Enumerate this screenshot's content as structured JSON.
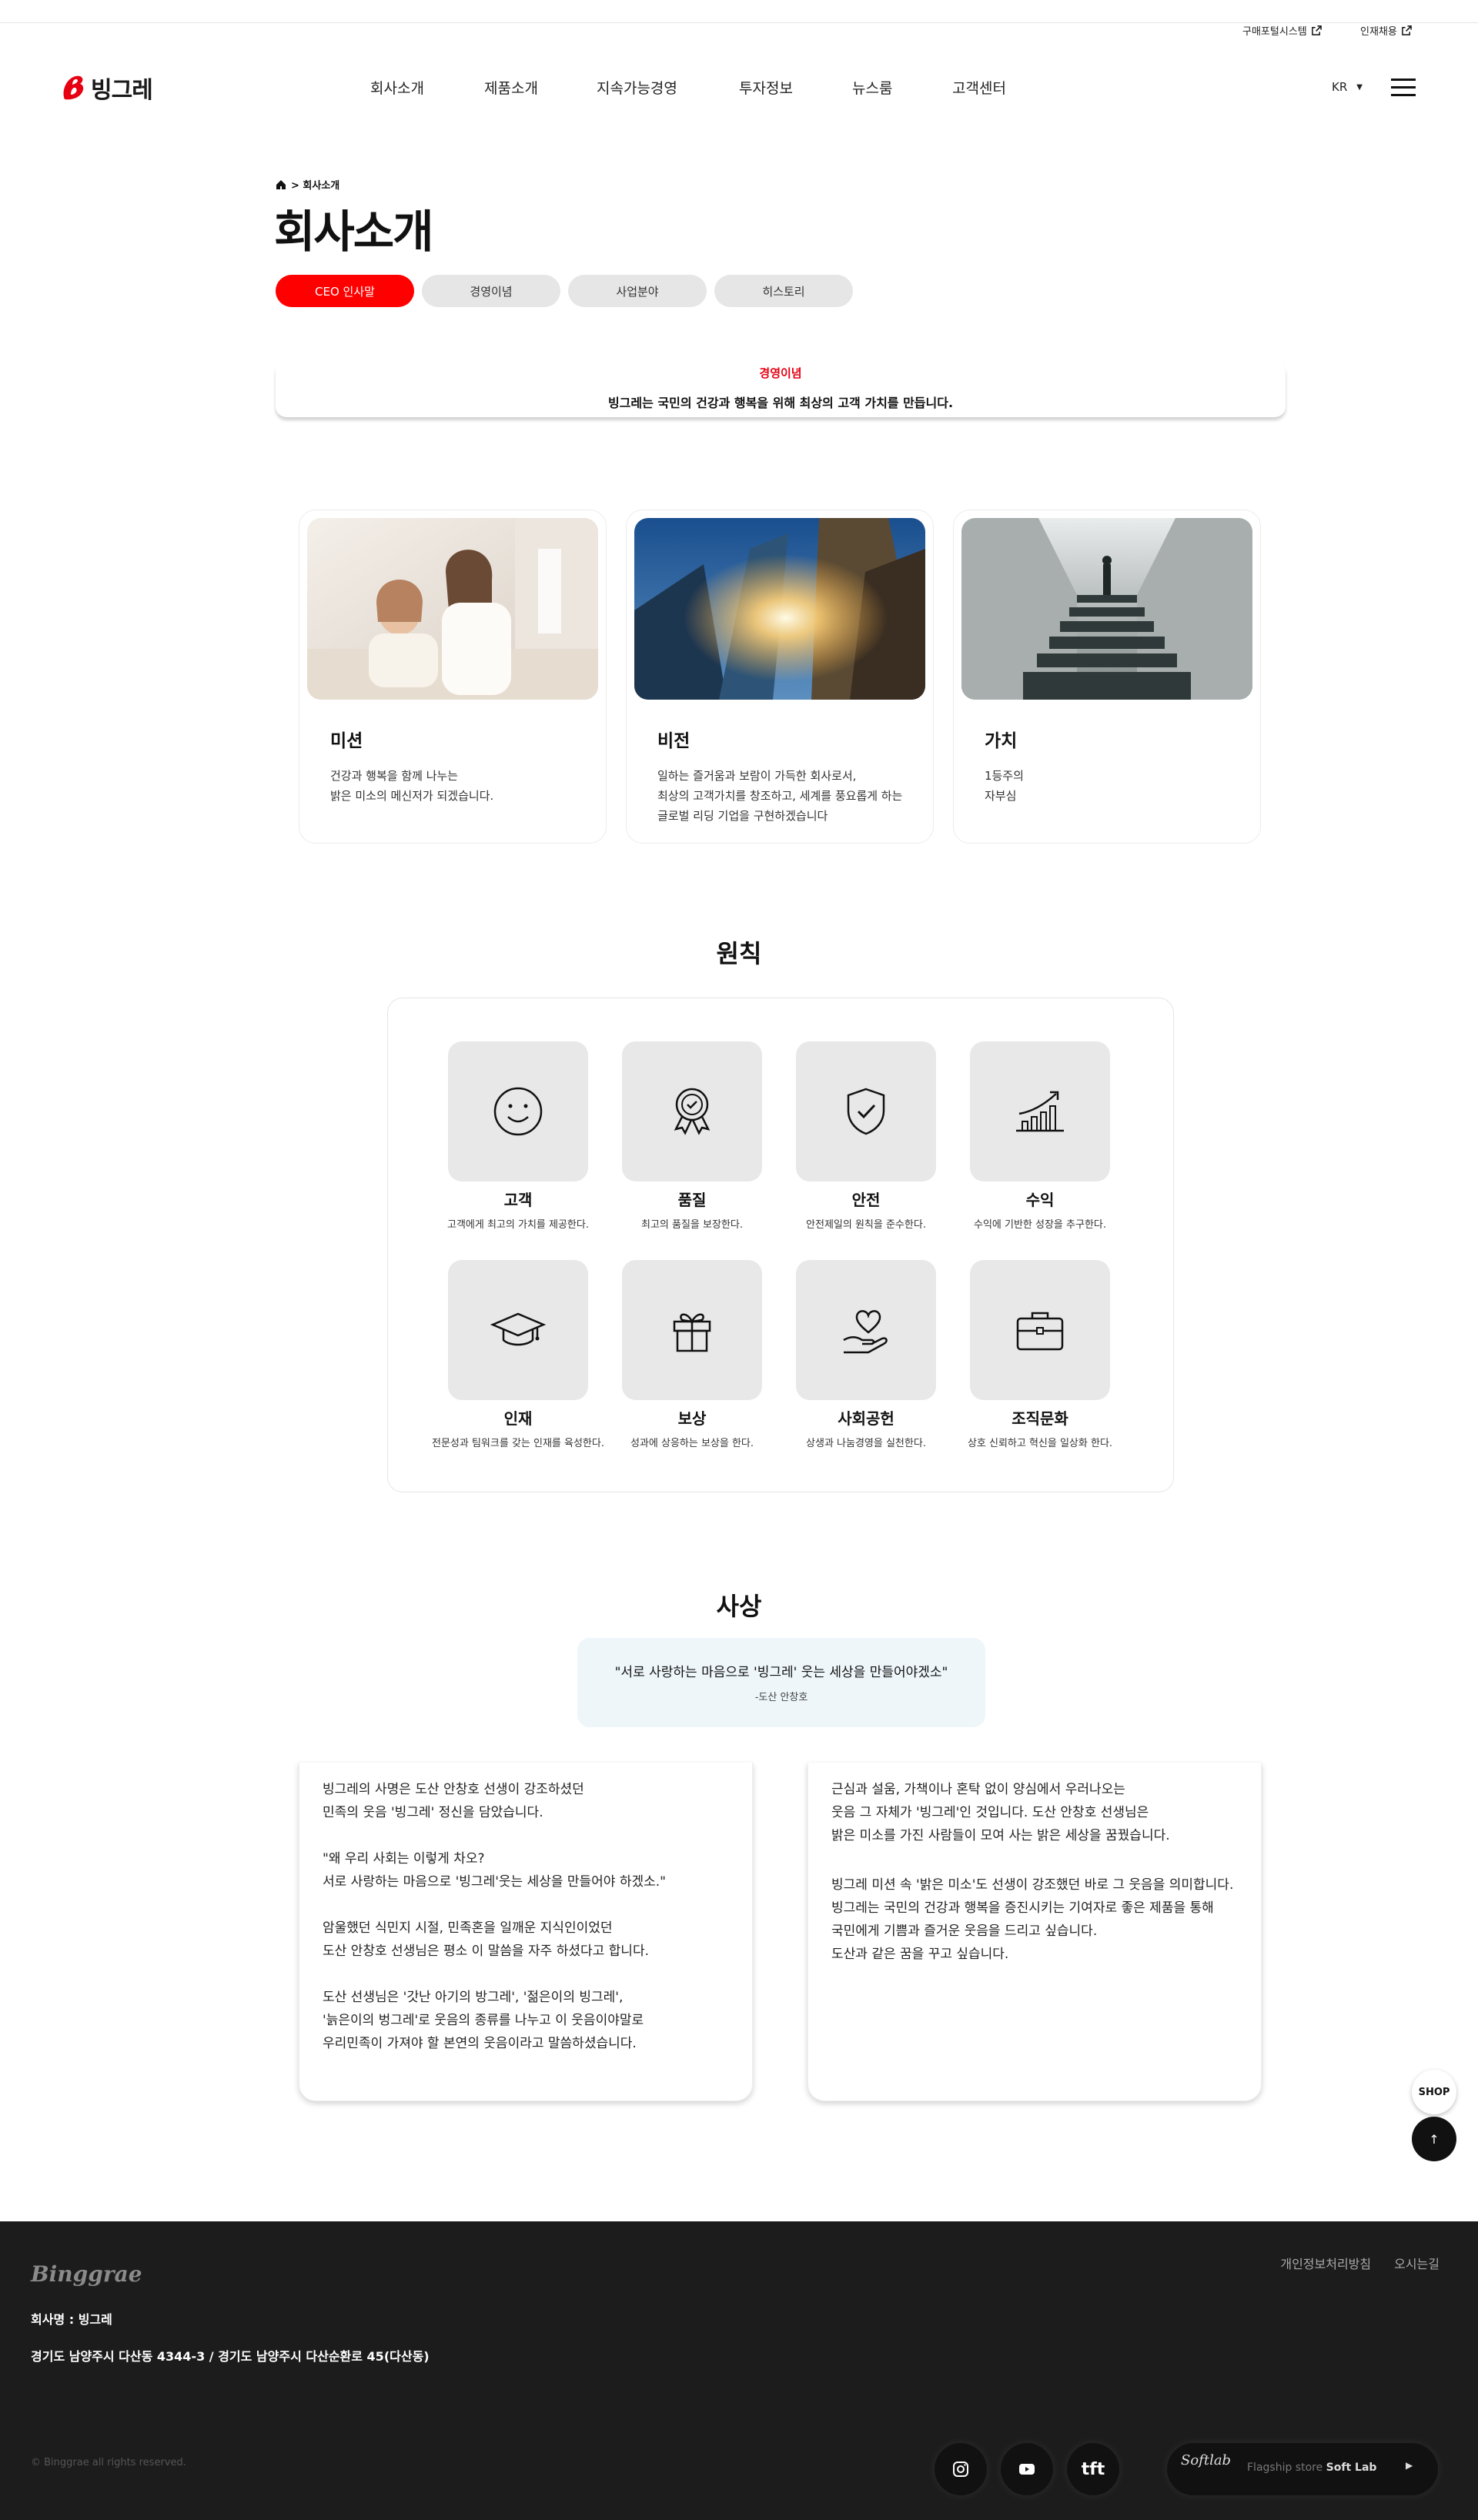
{
  "util": {
    "purchase_portal": "구매포털시스템",
    "recruit": "인재채용"
  },
  "header": {
    "logo_text": "빙그레",
    "nav": [
      "회사소개",
      "제품소개",
      "지속가능경영",
      "투자정보",
      "뉴스룸",
      "고객센터"
    ],
    "lang": "KR"
  },
  "page": {
    "breadcrumb": "> 회사소개",
    "title": "회사소개",
    "tabs": [
      "CEO 인사말",
      "경영이념",
      "사업분야",
      "히스토리"
    ]
  },
  "notice": {
    "label": "경영이념",
    "text": "빙그레는 국민의 건강과 행복을 위해 최상의 고객 가치를 만듭니다."
  },
  "cards": [
    {
      "title": "미션",
      "lines": [
        "건강과 행복을 함께 나누는",
        "밝은 미소의 메신저가 되겠습니다."
      ]
    },
    {
      "title": "비전",
      "lines": [
        "일하는 즐거움과 보람이 가득한 회사로서,",
        "최상의 고객가치를 창조하고, 세계를 풍요롭게 하는",
        "글로벌 리딩 기업을 구현하겠습니다"
      ]
    },
    {
      "title": "가치",
      "lines": [
        "1등주의",
        "자부심"
      ]
    }
  ],
  "principles": {
    "title": "원칙",
    "items": [
      {
        "title": "고객",
        "desc": "고객에게 최고의 가치를 제공한다.",
        "icon": "smile-icon"
      },
      {
        "title": "품질",
        "desc": "최고의 품질을 보장한다.",
        "icon": "medal-icon"
      },
      {
        "title": "안전",
        "desc": "안전제일의 원칙을 준수한다.",
        "icon": "shield-icon"
      },
      {
        "title": "수익",
        "desc": "수익에 기반한 성장을 추구한다.",
        "icon": "growth-chart-icon"
      },
      {
        "title": "인재",
        "desc": "전문성과 팀워크를 갖는 인재를 육성한다.",
        "icon": "graduation-cap-icon"
      },
      {
        "title": "보상",
        "desc": "성과에 상응하는 보상을 한다.",
        "icon": "gift-icon"
      },
      {
        "title": "사회공헌",
        "desc": "상생과 나눔경영을 실천한다.",
        "icon": "heart-hand-icon"
      },
      {
        "title": "조직문화",
        "desc": "상호 신뢰하고 혁신을 일상화 한다.",
        "icon": "briefcase-icon"
      }
    ]
  },
  "motto": {
    "title": "사상",
    "quote": "\"서로 사랑하는 마음으로 '빙그레' 웃는 세상을 만들어야겠소\"",
    "author": "-도산 안창호",
    "left_paragraphs": [
      [
        "빙그레의 사명은 도산 안창호 선생이 강조하셨던",
        "민족의 웃음 '빙그레' 정신을 담았습니다."
      ],
      [
        "\"왜 우리 사회는 이렇게 차오?",
        "서로 사랑하는 마음으로 '빙그레'웃는 세상을 만들어야 하겠소.\""
      ],
      [
        "암울했던 식민지 시절, 민족혼을 일깨운 지식인이었던",
        "도산 안창호 선생님은 평소 이 말씀을 자주 하셨다고 합니다."
      ],
      [
        "도산 선생님은 '갓난 아기의 방그레', '젊은이의 빙그레',",
        "'늙은이의 벙그레'로 웃음의 종류를 나누고 이 웃음이야말로",
        "우리민족이 가져야 할 본연의 웃음이라고 말씀하셨습니다."
      ]
    ],
    "right_paragraphs": [
      [
        "근심과 설움, 가책이나 혼탁 없이 양심에서 우러나오는",
        "웃음 그 자체가 '빙그레'인 것입니다. 도산 안창호 선생님은",
        "밝은 미소를 가진 사람들이 모여 사는 밝은 세상을 꿈꿨습니다."
      ],
      [
        "빙그레 미션 속 '밝은 미소'도 선생이 강조했던 바로 그 웃음을 의미합니다.",
        "빙그레는 국민의 건강과 행복을 증진시키는 기여자로 좋은 제품을 통해",
        "국민에게 기쁨과 즐거운 웃음을 드리고 싶습니다.",
        "도산과 같은 꿈을 꾸고 싶습니다."
      ]
    ]
  },
  "floating": {
    "shop": "SHOP",
    "top": "↑"
  },
  "footer": {
    "logo": "Binggrae",
    "links": [
      "개인정보처리방침",
      "오시는길"
    ],
    "company": "회사명 : 빙그레",
    "address": "경기도 남양주시 다산동 4344-3 / 경기도 남양주시 다산순환로 45(다산동)",
    "copyright": "© Binggrae all rights reserved.",
    "sns": [
      "instagram-icon",
      "youtube-icon",
      "tft-icon"
    ],
    "tft": "tft",
    "flagship_logo": "Softlab",
    "flagship_prefix": "Flagship store",
    "flagship_name": "Soft Lab",
    "flagship_arrow": "▶"
  },
  "colors": {
    "brand_red": "#e60012",
    "tab_active": "#ff0000",
    "footer_bg": "#1c1c1c",
    "quote_bg": "#eef6f9"
  }
}
